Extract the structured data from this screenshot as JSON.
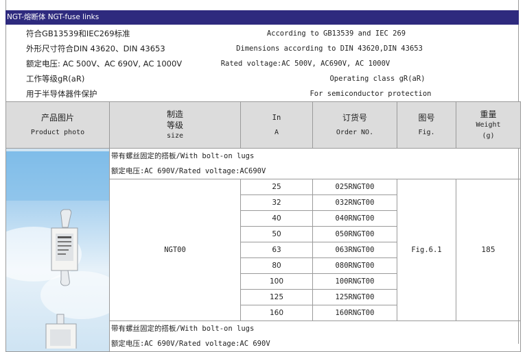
{
  "header": {
    "title": "NGT-熔断体 NGT-fuse links"
  },
  "specs": [
    {
      "cn": "符合GB13539和IEC269标准",
      "en": "According to GB13539 and IEC 269"
    },
    {
      "cn": "外形尺寸符合DIN 43620、DIN 43653",
      "en": "Dimensions according to DIN 43620,DIN 43653"
    },
    {
      "cn": "额定电压: AC 500V、AC 690V, AC 1000V",
      "en": "Rated voltage:AC 500V, AC690V, AC 1000V"
    },
    {
      "cn": "工作等级gR(aR)",
      "en": "Operating class gR(aR)"
    },
    {
      "cn": "用于半导体器件保护",
      "en": "For semiconductor protection"
    }
  ],
  "table": {
    "headers": {
      "photo": {
        "cn": "产品图片",
        "en": "Product photo"
      },
      "size": {
        "cn1": "制造",
        "cn2": "等级",
        "en": "size"
      },
      "in": {
        "cn": "In",
        "en": "A"
      },
      "order": {
        "cn": "订货号",
        "en": "Order NO."
      },
      "fig": {
        "cn": "图号",
        "en": "Fig."
      },
      "weight": {
        "cn": "重量",
        "en1": "Weight",
        "en2": "(g)"
      }
    },
    "group1": {
      "note1": "带有螺丝固定的搭板/With bolt-on lugs",
      "note2": "额定电压:AC 690V/Rated voltage:AC690V",
      "size": "NGT00",
      "fig": "Fig.6.1",
      "weight": "185",
      "rows": [
        {
          "in": "25",
          "order": "025RNGT00"
        },
        {
          "in": "32",
          "order": "032RNGT00"
        },
        {
          "in": "40",
          "order": "040RNGT00"
        },
        {
          "in": "50",
          "order": "050RNGT00"
        },
        {
          "in": "63",
          "order": "063RNGT00"
        },
        {
          "in": "80",
          "order": "080RNGT00"
        },
        {
          "in": "100",
          "order": "100RNGT00"
        },
        {
          "in": "125",
          "order": "125RNGT00"
        },
        {
          "in": "160",
          "order": "160RNGT00"
        }
      ]
    },
    "group2": {
      "note1": "带有螺丝固定的搭板/With bolt-on lugs",
      "note2": "额定电压:AC 690V/Rated voltage:AC 690V"
    }
  }
}
